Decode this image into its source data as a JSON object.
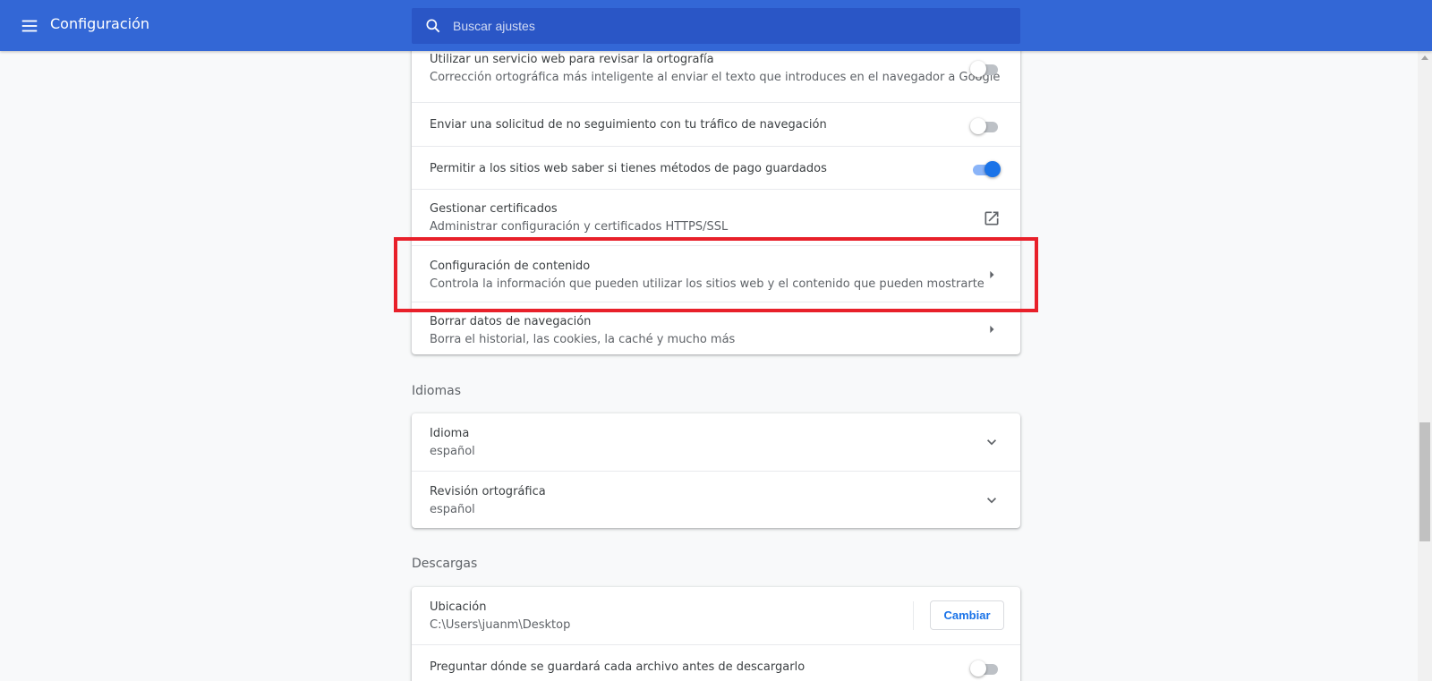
{
  "header": {
    "title": "Configuración",
    "search_placeholder": "Buscar ajustes"
  },
  "privacy_card": {
    "rows": [
      {
        "title": "Utilizar un servicio web para revisar la ortografía",
        "subtitle": "Corrección ortográfica más inteligente al enviar el texto que introduces en el navegador a Google",
        "control": "toggle",
        "checked": false
      },
      {
        "title": "Enviar una solicitud de no seguimiento con tu tráfico de navegación",
        "control": "toggle",
        "checked": false
      },
      {
        "title": "Permitir a los sitios web saber si tienes métodos de pago guardados",
        "control": "toggle",
        "checked": true
      },
      {
        "title": "Gestionar certificados",
        "subtitle": "Administrar configuración y certificados HTTPS/SSL",
        "control": "open-in-new-icon"
      },
      {
        "title": "Configuración de contenido",
        "subtitle": "Controla la información que pueden utilizar los sitios web y el contenido que pueden mostrarte",
        "control": "arrow-right-icon",
        "highlighted": true
      },
      {
        "title": "Borrar datos de navegación",
        "subtitle": "Borra el historial, las cookies, la caché y mucho más",
        "control": "arrow-right-icon"
      }
    ]
  },
  "languages": {
    "section_title": "Idiomas",
    "rows": [
      {
        "title": "Idioma",
        "subtitle": "español",
        "control": "chevron-down-icon"
      },
      {
        "title": "Revisión ortográfica",
        "subtitle": "español",
        "control": "chevron-down-icon"
      }
    ]
  },
  "downloads": {
    "section_title": "Descargas",
    "location_title": "Ubicación",
    "location_path": "C:\\Users\\juanm\\Desktop",
    "change_button": "Cambiar",
    "ask_title": "Preguntar dónde se guardará cada archivo antes de descargarlo",
    "ask_checked": false
  },
  "colors": {
    "toolbar": "#3367d6",
    "search": "#2a56c6",
    "accent": "#1a73e8",
    "highlight": "#e8202a"
  }
}
